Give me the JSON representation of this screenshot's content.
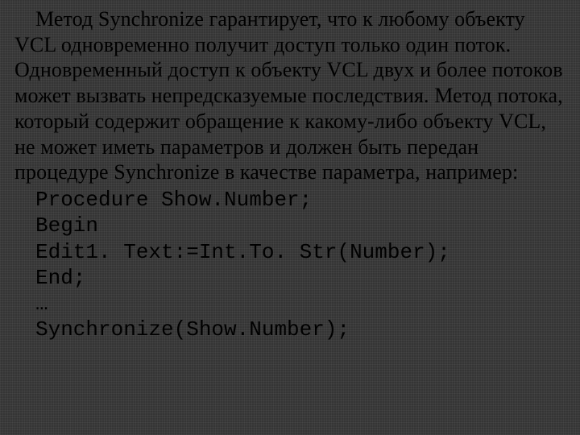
{
  "paragraph": "Метод Synchronize гарантирует, что к любому объекту VCL одновременно получит доступ только один поток. Одновременный доступ к объекту VCL двух и более потоков может вызвать непредсказуемые последствия. Метод потока, который содержит обращение к какому-либо объекту VCL, не может иметь параметров и должен быть передан процедуре Synchronize в качестве параметра, например:",
  "code": {
    "l1": "Procedure Show.Number;",
    "l2": "Begin",
    "l3": "Edit1. Text:=Int.To. Str(Number);",
    "l4": "End;",
    "l5": "…",
    "l6": "Synchronize(Show.Number);"
  }
}
